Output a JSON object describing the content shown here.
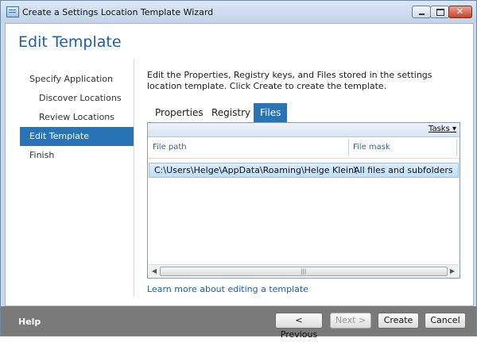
{
  "window": {
    "title": "Create a Settings Location Template Wizard"
  },
  "page": {
    "title": "Edit Template"
  },
  "nav": {
    "items": [
      {
        "label": "Specify Application"
      },
      {
        "label": "Discover Locations"
      },
      {
        "label": "Review Locations"
      },
      {
        "label": "Edit Template"
      },
      {
        "label": "Finish"
      }
    ]
  },
  "description": "Edit the Properties, Registry keys, and Files stored in the settings location template. Click Create to create the template.",
  "tabs": [
    {
      "label": "Properties"
    },
    {
      "label": "Registry"
    },
    {
      "label": "Files"
    }
  ],
  "grid": {
    "tasks_label": "Tasks",
    "columns": [
      "File path",
      "File mask"
    ],
    "rows": [
      [
        "C:\\Users\\Helge\\AppData\\Roaming\\Helge Klein\\",
        "All files and subfolders"
      ]
    ]
  },
  "learn_link": "Learn more about editing a template",
  "footer": {
    "help_label": "Help",
    "previous_label": "< Previous",
    "next_label": "Next >",
    "create_label": "Create",
    "cancel_label": "Cancel"
  }
}
